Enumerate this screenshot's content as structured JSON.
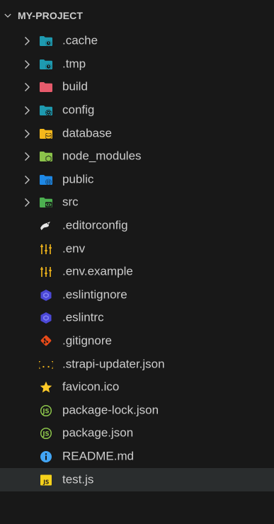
{
  "explorer": {
    "section_title": "MY-PROJECT",
    "items": [
      {
        "label": ".cache",
        "type": "folder",
        "icon": "folder-clock-icon",
        "color": "#1e9ab0"
      },
      {
        "label": ".tmp",
        "type": "folder",
        "icon": "folder-clock-icon",
        "color": "#1e9ab0"
      },
      {
        "label": "build",
        "type": "folder",
        "icon": "folder-build-icon",
        "color": "#e65b6c"
      },
      {
        "label": "config",
        "type": "folder",
        "icon": "folder-config-icon",
        "color": "#1e9ab0"
      },
      {
        "label": "database",
        "type": "folder",
        "icon": "folder-database-icon",
        "color": "#f5b81b"
      },
      {
        "label": "node_modules",
        "type": "folder",
        "icon": "folder-node-icon",
        "color": "#8bc34a"
      },
      {
        "label": "public",
        "type": "folder",
        "icon": "folder-public-icon",
        "color": "#1e88e5"
      },
      {
        "label": "src",
        "type": "folder",
        "icon": "folder-src-icon",
        "color": "#4caf50"
      },
      {
        "label": ".editorconfig",
        "type": "file",
        "icon": "editorconfig-icon",
        "color": "#e6e6e6"
      },
      {
        "label": ".env",
        "type": "file",
        "icon": "env-icon",
        "color": "#f5b81b"
      },
      {
        "label": ".env.example",
        "type": "file",
        "icon": "env-icon",
        "color": "#f5b81b"
      },
      {
        "label": ".eslintignore",
        "type": "file",
        "icon": "eslint-icon",
        "color": "#4b48d6"
      },
      {
        "label": ".eslintrc",
        "type": "file",
        "icon": "eslint-icon",
        "color": "#4b48d6"
      },
      {
        "label": ".gitignore",
        "type": "file",
        "icon": "git-icon",
        "color": "#e64a19"
      },
      {
        "label": ".strapi-updater.json",
        "type": "file",
        "icon": "json-icon",
        "color": "#f5b81b"
      },
      {
        "label": "favicon.ico",
        "type": "file",
        "icon": "star-icon",
        "color": "#ffca28"
      },
      {
        "label": "package-lock.json",
        "type": "file",
        "icon": "nodejs-icon",
        "color": "#8bc34a"
      },
      {
        "label": "package.json",
        "type": "file",
        "icon": "nodejs-icon",
        "color": "#8bc34a"
      },
      {
        "label": "README.md",
        "type": "file",
        "icon": "info-icon",
        "color": "#42a5f5"
      },
      {
        "label": "test.js",
        "type": "file",
        "icon": "javascript-icon",
        "color": "#f5d11b",
        "selected": true
      }
    ]
  }
}
